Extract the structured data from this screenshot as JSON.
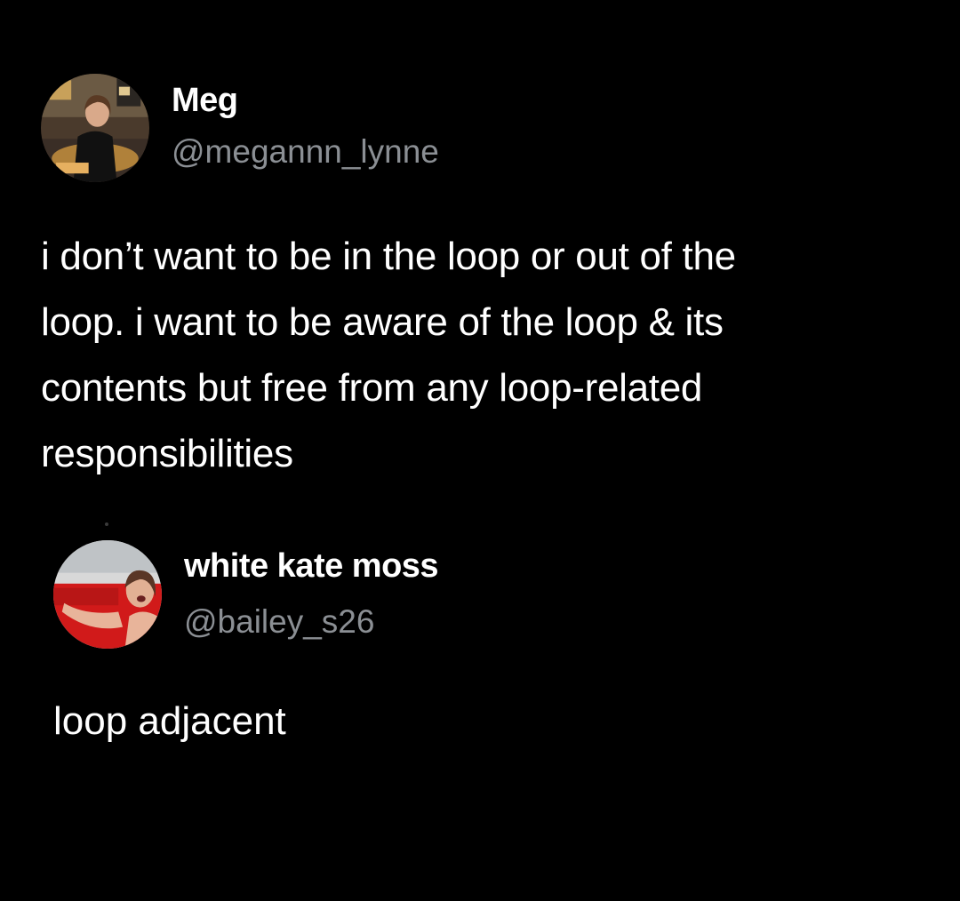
{
  "posts": [
    {
      "display_name": "Meg",
      "handle": "@megannn_lynne",
      "text": "i don’t want to be in the loop or out of the\nloop. i want to be aware of the loop & its\ncontents but free from any loop-related\nresponsibilities",
      "avatar_icon": "profile-photo"
    },
    {
      "display_name": "white kate moss",
      "handle": "@bailey_s26",
      "text": "loop adjacent",
      "avatar_icon": "profile-photo"
    }
  ],
  "colors": {
    "background": "#000000",
    "text": "#ffffff",
    "handle": "#8b8f94"
  }
}
